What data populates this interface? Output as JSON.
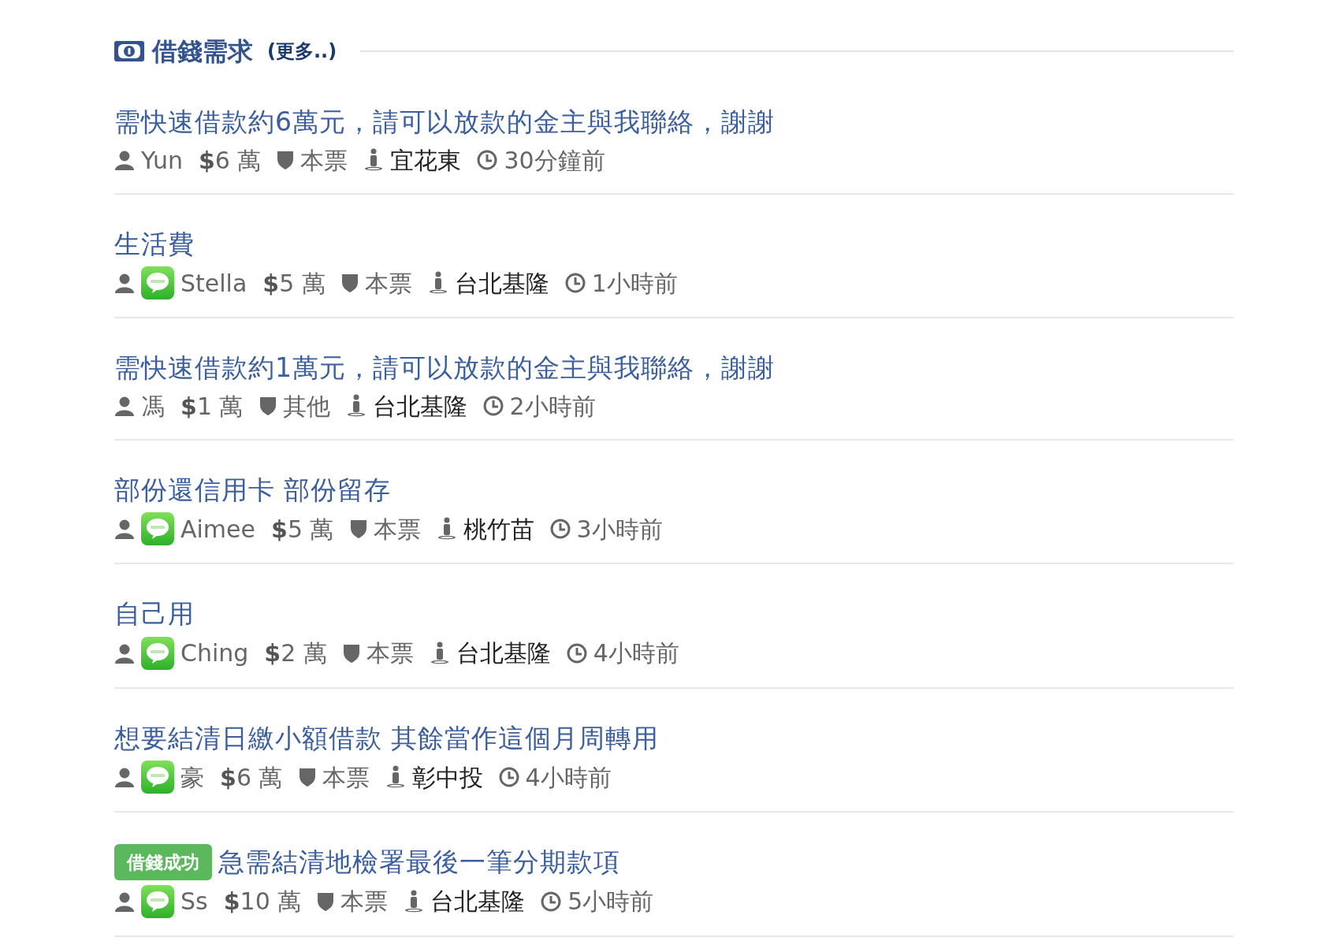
{
  "section": {
    "title": "借錢需求",
    "more": "(更多..)"
  },
  "loans": [
    {
      "title": "需快速借款約6萬元，請可以放款的金主與我聯絡，謝謝",
      "user": "Yun",
      "line": false,
      "amount": "**$**6 萬",
      "collateral": "本票",
      "region": "宜花東",
      "time": "30分鐘前"
    },
    {
      "title": "生活費",
      "user": "Stella",
      "line": true,
      "amount": "**$**5 萬",
      "collateral": "本票",
      "region": "台北基隆",
      "time": "1小時前"
    },
    {
      "title": "需快速借款約1萬元，請可以放款的金主與我聯絡，謝謝",
      "user": "馮",
      "line": false,
      "amount": "**$**1 萬",
      "collateral": "其他",
      "region": "台北基隆",
      "time": "2小時前"
    },
    {
      "title": "部份還信用卡 部份留存",
      "user": "Aimee",
      "line": true,
      "amount": "**$**5 萬",
      "collateral": "本票",
      "region": "桃竹苗",
      "time": "3小時前"
    },
    {
      "title": "自己用",
      "user": "Ching",
      "line": true,
      "amount": "**$**2 萬",
      "collateral": "本票",
      "region": "台北基隆",
      "time": "4小時前"
    },
    {
      "title": "想要結清日繳小額借款 其餘當作這個月周轉用",
      "user": "豪",
      "line": true,
      "amount": "**$**6 萬",
      "collateral": "本票",
      "region": "彰中投",
      "time": "4小時前"
    },
    {
      "title": "急需結清地檢署最後一筆分期款項",
      "badge": "借錢成功",
      "user": "Ss",
      "line": true,
      "amount": "**$**10 萬",
      "collateral": "本票",
      "region": "台北基隆",
      "time": "5小時前"
    }
  ]
}
